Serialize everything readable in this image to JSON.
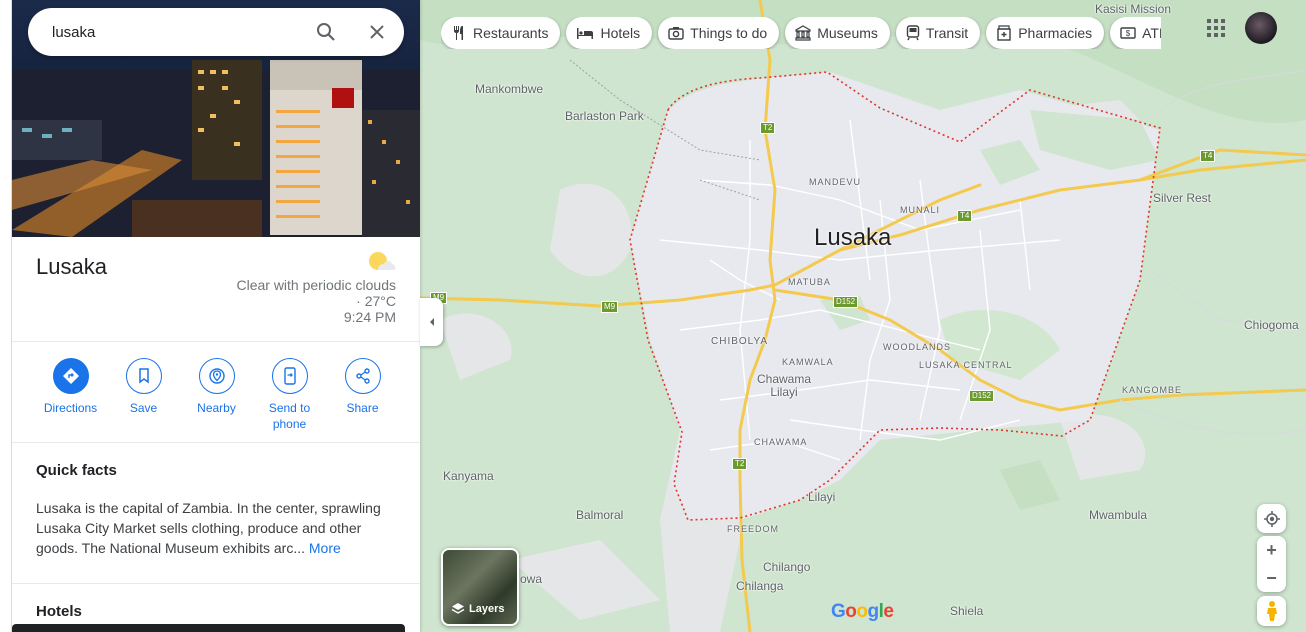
{
  "search": {
    "value": "lusaka"
  },
  "place": {
    "name": "Lusaka",
    "weather": "Clear with periodic clouds · 27°C",
    "time": "9:24 PM"
  },
  "actions": [
    {
      "label": "Directions",
      "icon": "directions-icon"
    },
    {
      "label": "Save",
      "icon": "bookmark-icon"
    },
    {
      "label": "Nearby",
      "icon": "nearby-icon"
    },
    {
      "label": "Send to phone",
      "icon": "send-to-phone-icon"
    },
    {
      "label": "Share",
      "icon": "share-icon"
    }
  ],
  "quick_facts": {
    "heading": "Quick facts",
    "text": "Lusaka is the capital of Zambia. In the center, sprawling Lusaka City Market sells clothing, produce and other goods. The National Museum exhibits arc...",
    "more": "More"
  },
  "hotels_heading": "Hotels",
  "chips": [
    {
      "label": "Restaurants",
      "icon": "restaurant-icon"
    },
    {
      "label": "Hotels",
      "icon": "hotel-icon"
    },
    {
      "label": "Things to do",
      "icon": "camera-icon"
    },
    {
      "label": "Museums",
      "icon": "museum-icon"
    },
    {
      "label": "Transit",
      "icon": "transit-icon"
    },
    {
      "label": "Pharmacies",
      "icon": "pharmacy-icon"
    },
    {
      "label": "ATMs",
      "icon": "atm-icon"
    }
  ],
  "map": {
    "city_label": "Lusaka",
    "places": {
      "kasisi": "Kasisi Mission",
      "mankombwe": "Mankombwe",
      "barlaston": "Barlaston Park",
      "mandevu": "MANDEVU",
      "munali": "MUNALI",
      "silver_rest": "Silver Rest",
      "matuba": "MATUBA",
      "chibolya": "CHIBOLYA",
      "kamwala": "KAMWALA",
      "chawama_lilayi": "Chawama Lilayi",
      "woodlands": "WOODLANDS",
      "lusaka_central": "LUSAKA CENTRAL",
      "chiogoma": "Chiogoma",
      "kangombe": "KANGOMBE",
      "chawama": "CHAWAMA",
      "kanyama": "Kanyama",
      "lilayi": "Lilayi",
      "balmoral": "Balmoral",
      "freedom": "FREEDOM",
      "mwambula": "Mwambula",
      "chilango": "Chilango",
      "chilanga": "Chilanga",
      "shiela": "Shiela",
      "owa": "owa"
    },
    "shields": {
      "t2_north": "T2",
      "t4_east": "T4",
      "t4_mid": "T4",
      "m9_west": "M9",
      "m9_mid": "M9",
      "d152_center": "D152",
      "d152_east": "D152",
      "t2_south": "T2"
    },
    "boundary_color": "#e0342b",
    "layers_label": "Layers",
    "logo": "Google"
  },
  "colors": {
    "accent": "#1a73e8",
    "urban": "#e8e9ee",
    "green": "#cfe5cf",
    "road": "#f6cf65"
  }
}
